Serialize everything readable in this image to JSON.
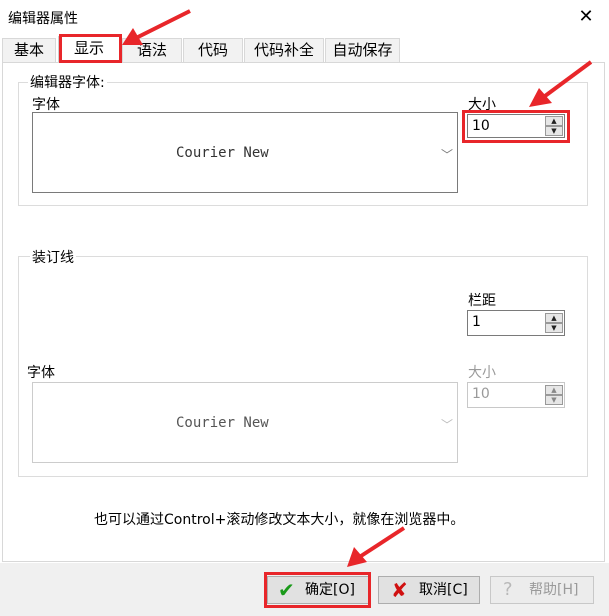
{
  "window": {
    "title": "编辑器属性",
    "close_icon": "close-icon"
  },
  "tabs": [
    {
      "label": "基本",
      "active": false
    },
    {
      "label": "显示",
      "active": true
    },
    {
      "label": "语法",
      "active": false
    },
    {
      "label": "代码",
      "active": false
    },
    {
      "label": "代码补全",
      "active": false
    },
    {
      "label": "自动保存",
      "active": false
    }
  ],
  "editor_font": {
    "legend": "编辑器字体",
    "font_label": "字体",
    "font_value": "Courier New",
    "size_label": "大小",
    "size_value": "10"
  },
  "gutter": {
    "legend": "装订线",
    "margin_label": "栏距",
    "margin_value": "1",
    "font_label": "字体",
    "font_value": "Courier New",
    "size_label": "大小",
    "size_value": "10"
  },
  "hint": "也可以通过Control+滚动修改文本大小，就像在浏览器中。",
  "buttons": {
    "ok": "确定[O]",
    "cancel": "取消[C]",
    "help": "帮助[H]"
  },
  "colors": {
    "annotation": "#e8262a",
    "ok_icon": "#1a9a1a",
    "cancel_icon": "#d01010"
  }
}
